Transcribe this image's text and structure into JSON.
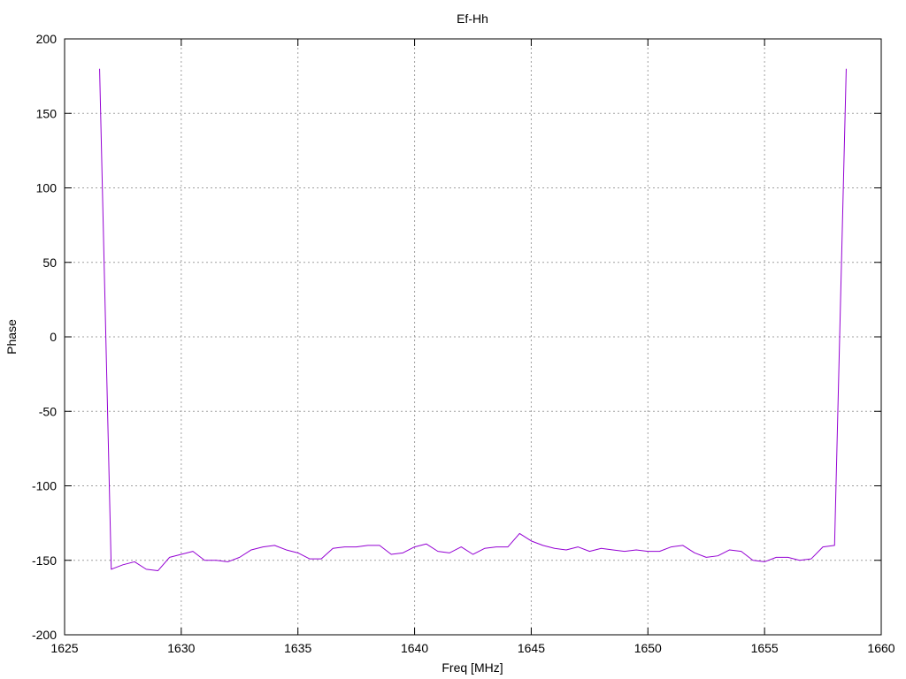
{
  "chart_data": {
    "type": "line",
    "title": "Ef-Hh",
    "xlabel": "Freq [MHz]",
    "ylabel": "Phase",
    "xlim": [
      1625,
      1660
    ],
    "ylim": [
      -200,
      200
    ],
    "xticks": [
      1625,
      1630,
      1635,
      1640,
      1645,
      1650,
      1655,
      1660
    ],
    "yticks": [
      -200,
      -150,
      -100,
      -50,
      0,
      50,
      100,
      150,
      200
    ],
    "grid": true,
    "legend": "none",
    "series": [
      {
        "color": "#9400d3",
        "x": [
          1626.5,
          1627.0,
          1627.5,
          1628.0,
          1628.5,
          1629.0,
          1629.5,
          1630.0,
          1630.5,
          1631.0,
          1631.5,
          1632.0,
          1632.5,
          1633.0,
          1633.5,
          1634.0,
          1634.5,
          1635.0,
          1635.5,
          1636.0,
          1636.5,
          1637.0,
          1637.5,
          1638.0,
          1638.5,
          1639.0,
          1639.5,
          1640.0,
          1640.5,
          1641.0,
          1641.5,
          1642.0,
          1642.5,
          1643.0,
          1643.5,
          1644.0,
          1644.5,
          1645.0,
          1645.5,
          1646.0,
          1646.5,
          1647.0,
          1647.5,
          1648.0,
          1648.5,
          1649.0,
          1649.5,
          1650.0,
          1650.5,
          1651.0,
          1651.5,
          1652.0,
          1652.5,
          1653.0,
          1653.5,
          1654.0,
          1654.5,
          1655.0,
          1655.5,
          1656.0,
          1656.5,
          1657.0,
          1657.5,
          1658.0,
          1658.5
        ],
        "y": [
          180,
          -156,
          -153,
          -151,
          -156,
          -157,
          -148,
          -146,
          -144,
          -150,
          -150,
          -151,
          -148,
          -143,
          -141,
          -140,
          -143,
          -145,
          -149,
          -149,
          -142,
          -141,
          -141,
          -140,
          -140,
          -146,
          -145,
          -141,
          -139,
          -144,
          -145,
          -141,
          -146,
          -142,
          -141,
          -141,
          -132,
          -137,
          -140,
          -142,
          -143,
          -141,
          -144,
          -142,
          -143,
          -144,
          -143,
          -144,
          -144,
          -141,
          -140,
          -145,
          -148,
          -147,
          -143,
          -144,
          -150,
          -151,
          -148,
          -148,
          -150,
          -149,
          -141,
          -140,
          180
        ]
      }
    ]
  }
}
